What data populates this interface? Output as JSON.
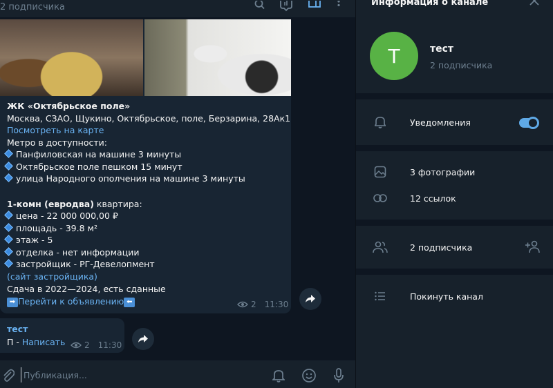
{
  "header": {
    "subtitle": "2 подписчика"
  },
  "post": {
    "title": "ЖК «Октябрьское поле»",
    "address": "Москва, СЗАО, Щукино, Октябрьское, поле, Берзарина, 28Ак1",
    "map_link": "Посмотреть на карте",
    "metro_heading": "Метро в доступности:",
    "metro": [
      "Панфиловская на машине 3 минуты",
      "Октябрьское поле пешком 15 минут",
      "улица Народного ополчения на машине 3 минуты"
    ],
    "apt_bold": "1-комн (евродва)",
    "apt_rest": " квартира:",
    "details": [
      "цена - 22 000 000,00 ₽",
      "площадь - 39.8 м²",
      "этаж - 5",
      "отделка - нет информации",
      "застройщик - РГ-Девелопмент"
    ],
    "dev_link": "(сайт застройщика)",
    "delivery": "Сдача в 2022—2024, есть сданные",
    "ad_link": "Перейти к объявлению",
    "views": "2",
    "time": "11:30"
  },
  "message2": {
    "author": "тест",
    "prefix": "П - ",
    "link": "Написать",
    "views": "2",
    "time": "11:30"
  },
  "composer": {
    "placeholder": "Публикация..."
  },
  "panel": {
    "title": "Информация о канале",
    "avatar_letter": "Т",
    "name": "тест",
    "subscribers": "2 подписчика",
    "notifications": "Уведомления",
    "notifications_on": true,
    "photos": "3 фотографии",
    "links": "12 ссылок",
    "members": "2 подписчика",
    "leave": "Покинуть канал"
  },
  "colors": {
    "accent": "#6ab3f3",
    "avatar": "#58b245",
    "bubble": "#182533",
    "background": "#0e1621",
    "panel": "#17212b"
  }
}
